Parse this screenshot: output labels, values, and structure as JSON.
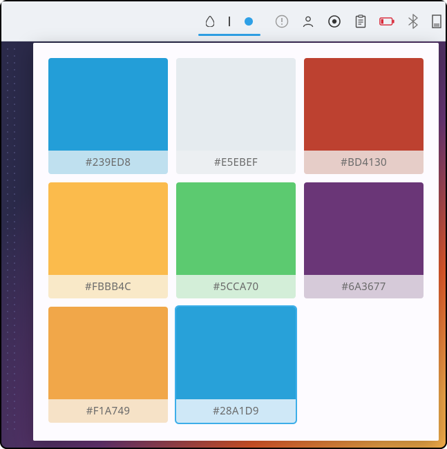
{
  "tray": {
    "picker_tabs": [
      "droplet",
      "pipe",
      "dot"
    ],
    "icons": [
      "alert",
      "user",
      "target",
      "clipboard",
      "battery-low",
      "bluetooth",
      "drive"
    ]
  },
  "swatches": [
    {
      "hex": "#239ED8",
      "label_bg": "#bfe0ef",
      "selected": false
    },
    {
      "hex": "#E5EBEF",
      "label_bg": "#eceff2",
      "selected": false
    },
    {
      "hex": "#BD4130",
      "label_bg": "#e6cdc8",
      "selected": false
    },
    {
      "hex": "#FBBB4C",
      "label_bg": "#f9e9c8",
      "selected": false
    },
    {
      "hex": "#5CCA70",
      "label_bg": "#d3eed8",
      "selected": false
    },
    {
      "hex": "#6A3677",
      "label_bg": "#d6cad9",
      "selected": false
    },
    {
      "hex": "#F1A749",
      "label_bg": "#f6e2c7",
      "selected": false
    },
    {
      "hex": "#28A1D9",
      "label_bg": "#cfe8f7",
      "selected": true
    }
  ]
}
